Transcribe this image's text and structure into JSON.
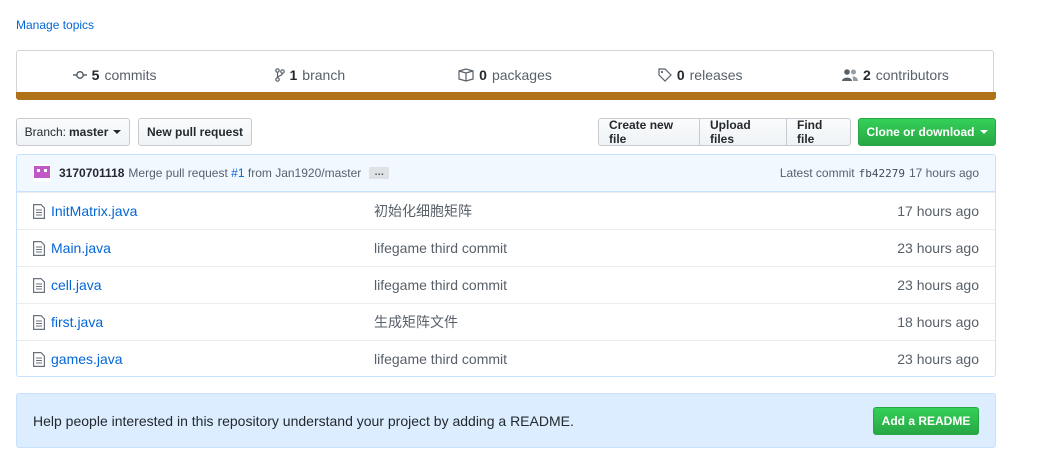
{
  "manage_topics": "Manage topics",
  "stats": [
    {
      "icon": "commit-icon",
      "count": "5",
      "label": "commits"
    },
    {
      "icon": "branch-icon",
      "count": "1",
      "label": "branch"
    },
    {
      "icon": "package-icon",
      "count": "0",
      "label": "packages"
    },
    {
      "icon": "tag-icon",
      "count": "0",
      "label": "releases"
    },
    {
      "icon": "people-icon",
      "count": "2",
      "label": "contributors"
    }
  ],
  "language_color": "#b07219",
  "toolbar": {
    "branch_label": "Branch:",
    "branch_name": "master",
    "new_pull_request": "New pull request",
    "create_new_file": "Create new file",
    "upload_files": "Upload files",
    "find_file": "Find file",
    "clone_or_download": "Clone or download"
  },
  "latest_commit": {
    "author": "3170701118",
    "message_prefix": "Merge pull request",
    "pr_ref": "#1",
    "message_suffix": "from Jan1920/master",
    "ellipsis": "…",
    "latest_label": "Latest commit",
    "sha": "fb42279",
    "age": "17 hours ago"
  },
  "files": [
    {
      "name": "InitMatrix.java",
      "message": "初始化细胞矩阵",
      "age": "17 hours ago"
    },
    {
      "name": "Main.java",
      "message": "lifegame third commit",
      "age": "23 hours ago"
    },
    {
      "name": "cell.java",
      "message": "lifegame third commit",
      "age": "23 hours ago"
    },
    {
      "name": "first.java",
      "message": "生成矩阵文件",
      "age": "18 hours ago"
    },
    {
      "name": "games.java",
      "message": "lifegame third commit",
      "age": "23 hours ago"
    }
  ],
  "readme": {
    "text": "Help people interested in this repository understand your project by adding a README.",
    "button": "Add a README"
  }
}
